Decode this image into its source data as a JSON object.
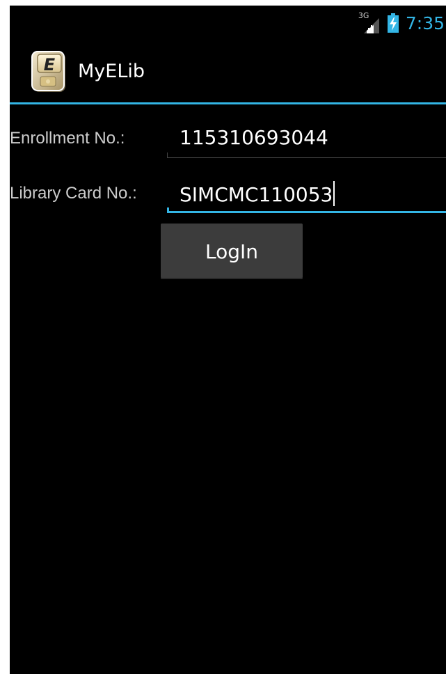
{
  "status_bar": {
    "network_type": "3G",
    "time": "7:35",
    "accent_color": "#33b5e5"
  },
  "action_bar": {
    "app_icon": "elib-book-icon",
    "app_icon_letter": "E",
    "title": "MyELib"
  },
  "form": {
    "enrollment": {
      "label": "Enrollment No.:",
      "value": "115310693044"
    },
    "library_card": {
      "label": "Library Card No.:",
      "value": "SIMCMC110053",
      "focused": true
    },
    "login_label": "LogIn"
  }
}
